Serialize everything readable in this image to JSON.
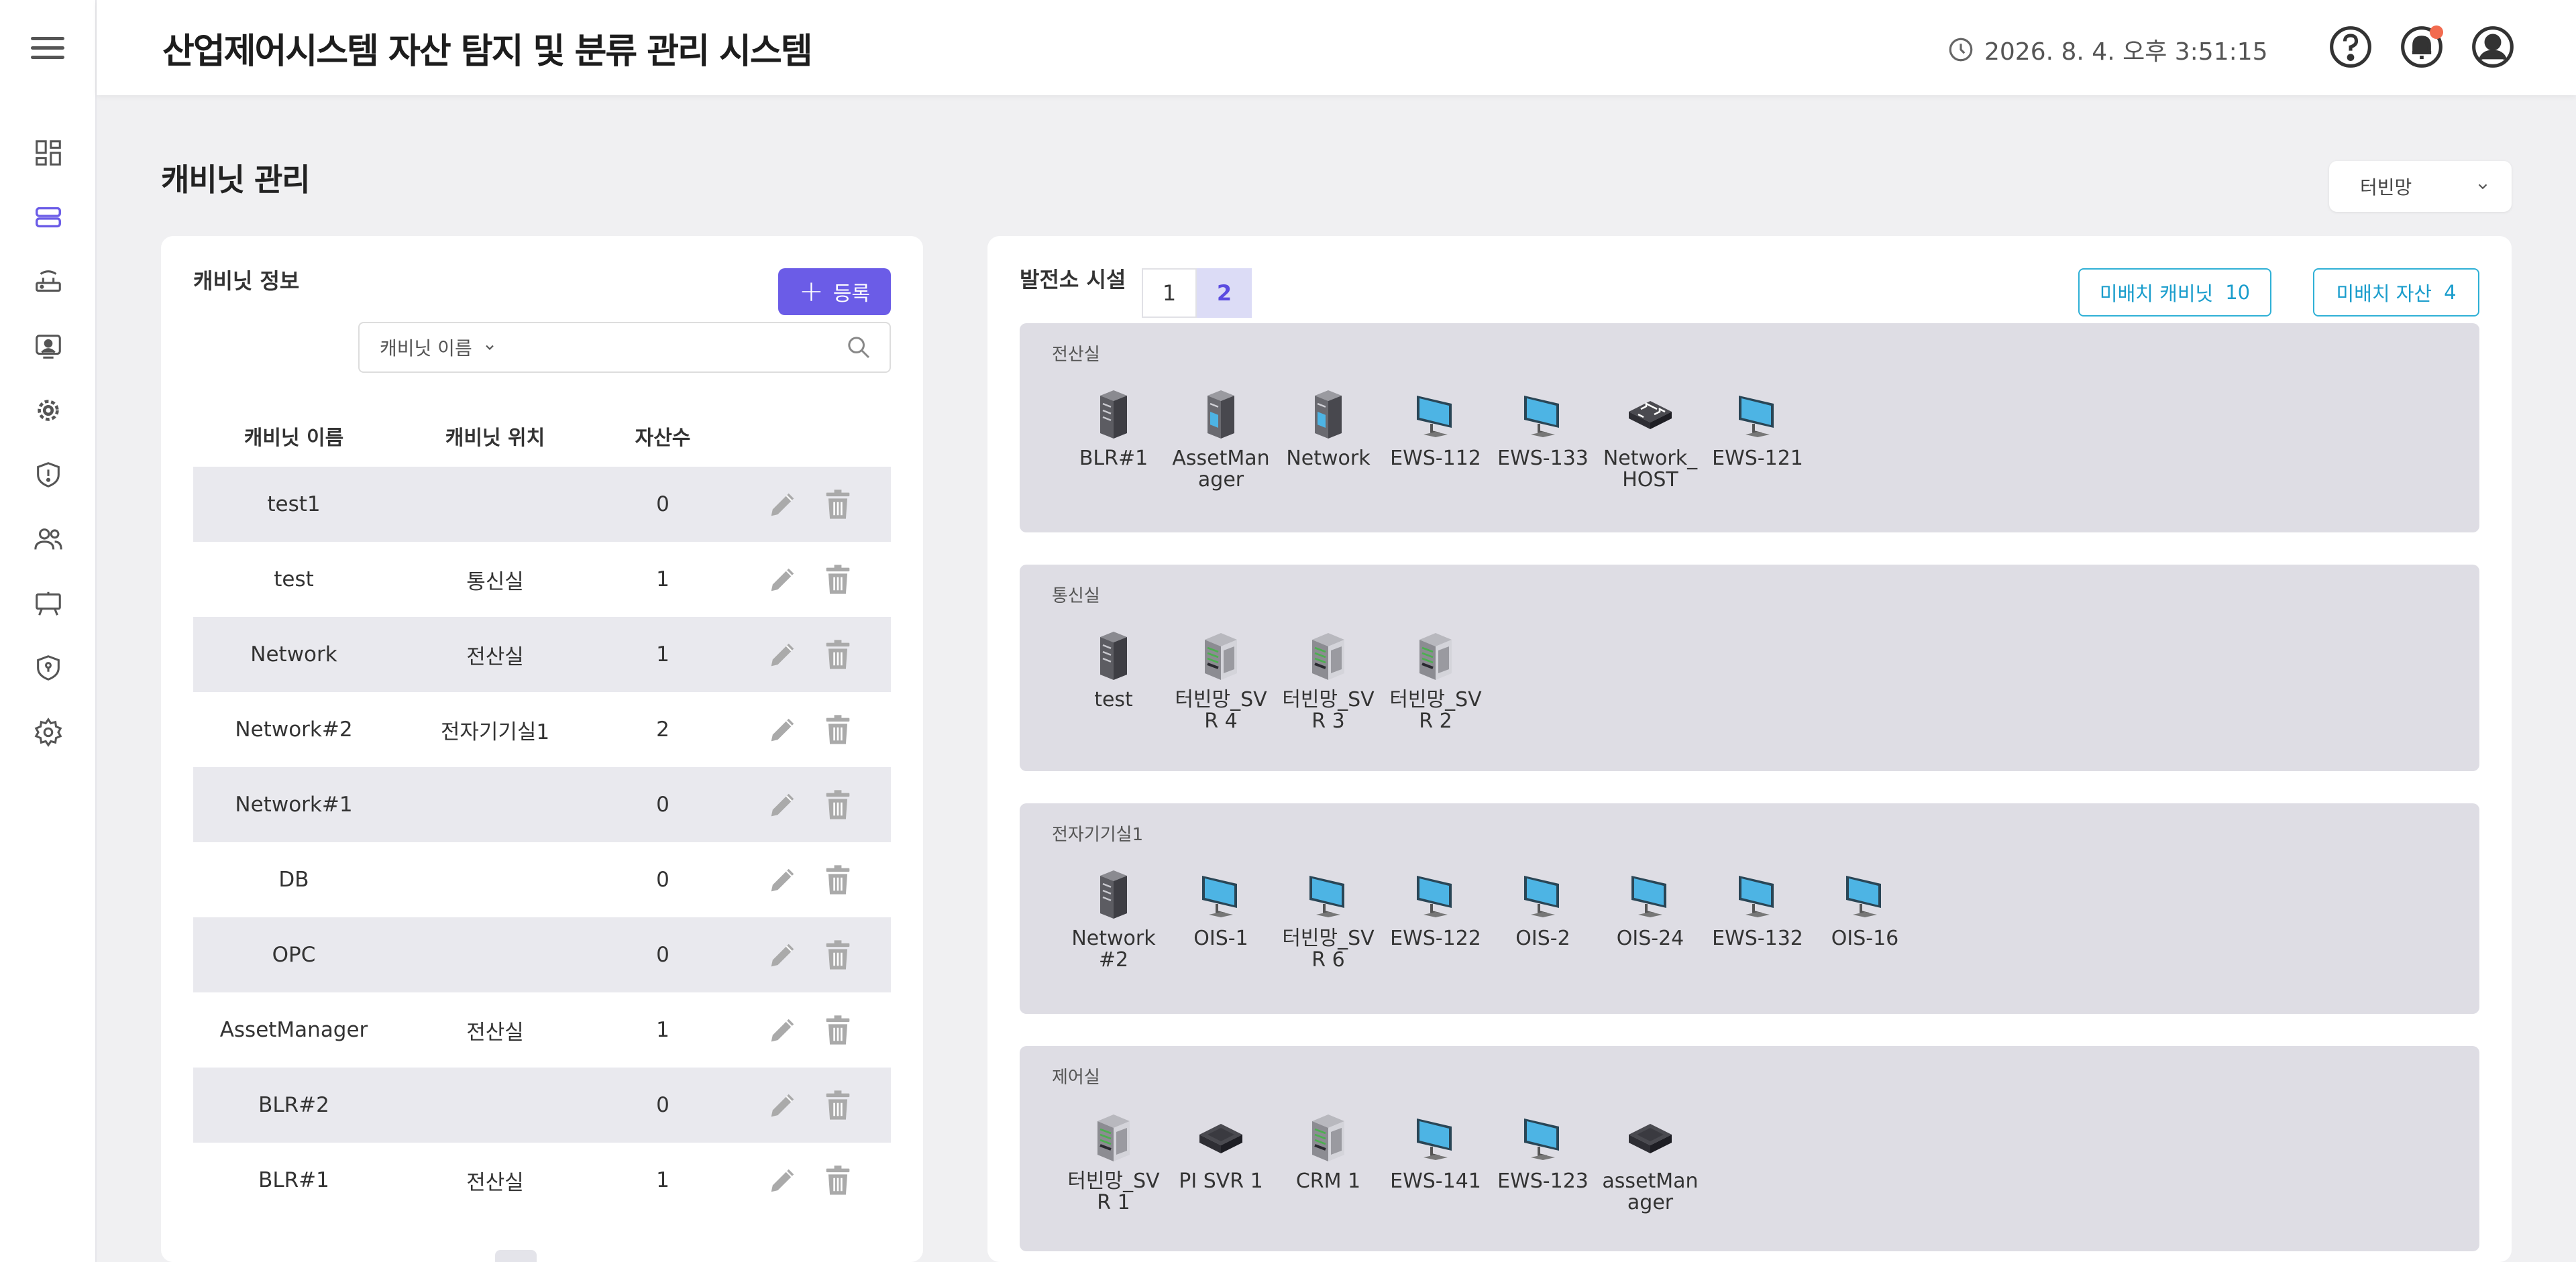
{
  "header": {
    "title": "산업제어시스템 자산 탐지 및 분류 관리 시스템",
    "clock": "2026. 8. 4. 오후 3:51:15"
  },
  "icons": {
    "menu": "hamburger-menu-icon",
    "help": "help-icon",
    "notification": "bell-icon",
    "account": "user-account-icon",
    "clock": "clock-icon"
  },
  "colors": {
    "primary": "#6b5ce7",
    "outline": "#2fb0d6",
    "notification_dot": "#f26b4f",
    "monitor": "#4db4e4"
  },
  "page": {
    "title": "캐비닛 관리",
    "line_select": "터빈망"
  },
  "cabinet_panel": {
    "heading": "캐비닛 정보",
    "register_label": "등록",
    "search_filter": "캐비닛 이름",
    "search_value": "",
    "columns": [
      "캐비닛 이름",
      "캐비닛 위치",
      "자산수"
    ],
    "rows": [
      {
        "name": "test1",
        "location": "",
        "count": "0"
      },
      {
        "name": "test",
        "location": "통신실",
        "count": "1"
      },
      {
        "name": "Network",
        "location": "전산실",
        "count": "1"
      },
      {
        "name": "Network#2",
        "location": "전자기기실1",
        "count": "2"
      },
      {
        "name": "Network#1",
        "location": "",
        "count": "0"
      },
      {
        "name": "DB",
        "location": "",
        "count": "0"
      },
      {
        "name": "OPC",
        "location": "",
        "count": "0"
      },
      {
        "name": "AssetManager",
        "location": "전산실",
        "count": "1"
      },
      {
        "name": "BLR#2",
        "location": "",
        "count": "0"
      },
      {
        "name": "BLR#1",
        "location": "전산실",
        "count": "1"
      }
    ]
  },
  "facility_panel": {
    "heading": "발전소 시설",
    "pages": [
      "1",
      "2"
    ],
    "active_page": "2",
    "unplaced_cabinet": {
      "label": "미배치 캐비닛",
      "count": "10"
    },
    "unplaced_asset": {
      "label": "미배치 자산",
      "count": "4"
    },
    "rooms": [
      {
        "name": "전산실",
        "devices": [
          {
            "label": "BLR#1",
            "type": "server"
          },
          {
            "label": "AssetManager",
            "type": "server-blue"
          },
          {
            "label": "Network",
            "type": "server-blue"
          },
          {
            "label": "EWS-112",
            "type": "monitor"
          },
          {
            "label": "EWS-133",
            "type": "monitor"
          },
          {
            "label": "Network_HOST",
            "type": "switch"
          },
          {
            "label": "EWS-121",
            "type": "monitor"
          }
        ]
      },
      {
        "name": "통신실",
        "devices": [
          {
            "label": "test",
            "type": "server"
          },
          {
            "label": "터빈망_SVR 4",
            "type": "rack"
          },
          {
            "label": "터빈망_SVR 3",
            "type": "rack"
          },
          {
            "label": "터빈망_SVR 2",
            "type": "rack"
          }
        ]
      },
      {
        "name": "전자기기실1",
        "devices": [
          {
            "label": "Network#2",
            "type": "server"
          },
          {
            "label": "OIS-1",
            "type": "monitor"
          },
          {
            "label": "터빈망_SVR 6",
            "type": "monitor"
          },
          {
            "label": "EWS-122",
            "type": "monitor"
          },
          {
            "label": "OIS-2",
            "type": "monitor"
          },
          {
            "label": "OIS-24",
            "type": "monitor"
          },
          {
            "label": "EWS-132",
            "type": "monitor"
          },
          {
            "label": "OIS-16",
            "type": "monitor"
          }
        ]
      },
      {
        "name": "제어실",
        "devices": [
          {
            "label": "터빈망_SVR 1",
            "type": "rack"
          },
          {
            "label": "PI SVR 1",
            "type": "hub"
          },
          {
            "label": "CRM 1",
            "type": "rack"
          },
          {
            "label": "EWS-141",
            "type": "monitor"
          },
          {
            "label": "EWS-123",
            "type": "monitor"
          },
          {
            "label": "assetManager",
            "type": "hub"
          }
        ]
      }
    ]
  }
}
